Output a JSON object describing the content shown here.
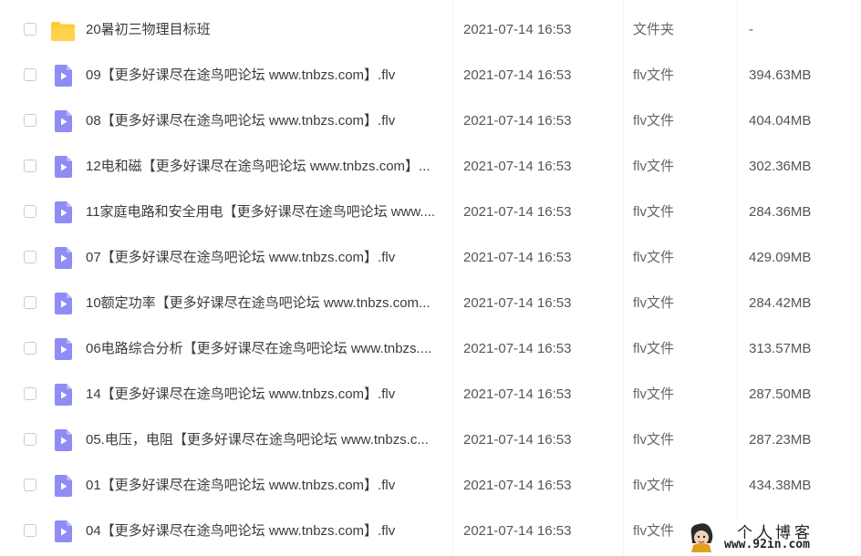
{
  "files": [
    {
      "name": "20暑初三物理目标班",
      "date": "2021-07-14 16:53",
      "type": "文件夹",
      "size": "-",
      "icon": "folder-icon"
    },
    {
      "name": "09【更多好课尽在途鸟吧论坛 www.tnbzs.com】.flv",
      "date": "2021-07-14 16:53",
      "type": "flv文件",
      "size": "394.63MB",
      "icon": "video-file-icon"
    },
    {
      "name": "08【更多好课尽在途鸟吧论坛 www.tnbzs.com】.flv",
      "date": "2021-07-14 16:53",
      "type": "flv文件",
      "size": "404.04MB",
      "icon": "video-file-icon"
    },
    {
      "name": "12电和磁【更多好课尽在途鸟吧论坛 www.tnbzs.com】...",
      "date": "2021-07-14 16:53",
      "type": "flv文件",
      "size": "302.36MB",
      "icon": "video-file-icon"
    },
    {
      "name": "11家庭电路和安全用电【更多好课尽在途鸟吧论坛 www....",
      "date": "2021-07-14 16:53",
      "type": "flv文件",
      "size": "284.36MB",
      "icon": "video-file-icon"
    },
    {
      "name": "07【更多好课尽在途鸟吧论坛 www.tnbzs.com】.flv",
      "date": "2021-07-14 16:53",
      "type": "flv文件",
      "size": "429.09MB",
      "icon": "video-file-icon"
    },
    {
      "name": "10额定功率【更多好课尽在途鸟吧论坛 www.tnbzs.com...",
      "date": "2021-07-14 16:53",
      "type": "flv文件",
      "size": "284.42MB",
      "icon": "video-file-icon"
    },
    {
      "name": "06电路综合分析【更多好课尽在途鸟吧论坛 www.tnbzs....",
      "date": "2021-07-14 16:53",
      "type": "flv文件",
      "size": "313.57MB",
      "icon": "video-file-icon"
    },
    {
      "name": "14【更多好课尽在途鸟吧论坛 www.tnbzs.com】.flv",
      "date": "2021-07-14 16:53",
      "type": "flv文件",
      "size": "287.50MB",
      "icon": "video-file-icon"
    },
    {
      "name": "05.电压，电阻【更多好课尽在途鸟吧论坛 www.tnbzs.c...",
      "date": "2021-07-14 16:53",
      "type": "flv文件",
      "size": "287.23MB",
      "icon": "video-file-icon"
    },
    {
      "name": "01【更多好课尽在途鸟吧论坛 www.tnbzs.com】.flv",
      "date": "2021-07-14 16:53",
      "type": "flv文件",
      "size": "434.38MB",
      "icon": "video-file-icon"
    },
    {
      "name": "04【更多好课尽在途鸟吧论坛 www.tnbzs.com】.flv",
      "date": "2021-07-14 16:53",
      "type": "flv文件",
      "size": "",
      "icon": "video-file-icon"
    }
  ],
  "watermark": {
    "title": "个人博客",
    "url": "www.92in.com"
  },
  "colors": {
    "folder": "#ffcc33",
    "video_icon": "#8f8cf5",
    "divider": "#f1f2f5"
  }
}
